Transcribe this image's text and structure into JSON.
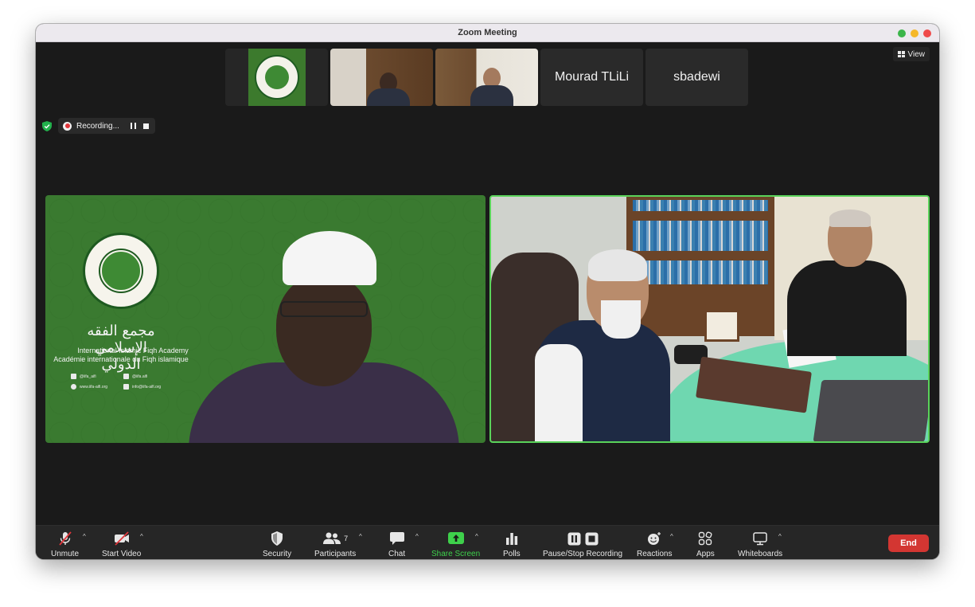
{
  "window": {
    "title": "Zoom Meeting"
  },
  "view_button": {
    "label": "View"
  },
  "thumbnails": [
    {
      "type": "logo"
    },
    {
      "type": "video"
    },
    {
      "type": "video"
    },
    {
      "type": "name",
      "name": "Mourad TLiLi"
    },
    {
      "type": "name",
      "name": "sbadewi"
    }
  ],
  "recording": {
    "label": "Recording..."
  },
  "tiles": {
    "left": {
      "org_arabic": "مجمع الفقه الإسلامي الدولي",
      "org_english": "International Islamic Fiqh Academy",
      "org_french": "Académie internationale du Fiqh islamique",
      "contacts": [
        "@iifa_aifi",
        "@iifa.aifi",
        "www.iifa-aifi.org",
        "info@iifa-aifi.org"
      ]
    }
  },
  "toolbar": {
    "unmute": "Unmute",
    "start_video": "Start Video",
    "security": "Security",
    "participants": "Participants",
    "participants_count": "7",
    "chat": "Chat",
    "share_screen": "Share Screen",
    "polls": "Polls",
    "pause_stop_recording": "Pause/Stop Recording",
    "reactions": "Reactions",
    "apps": "Apps",
    "whiteboards": "Whiteboards",
    "end": "End"
  },
  "colors": {
    "accent_green": "#3ed04b",
    "end_red": "#d33632",
    "active_border": "#5ad35a"
  }
}
